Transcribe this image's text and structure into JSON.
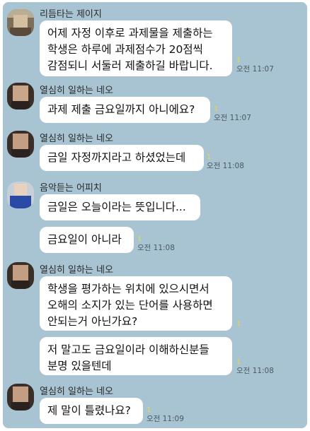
{
  "messages": [
    {
      "sender": "리듬타는 제이지",
      "lines": [
        "어제 자정 이후로 과제물을 제출하는",
        "학생은 하루에 과제점수가 20점씩",
        "감점되니 서둘러 제출하길 바랍니다."
      ],
      "read": "1",
      "time": "오전 11:07"
    },
    {
      "sender": "열심히 일하는 네오",
      "lines": [
        "과제 제출 금요일까지 아니에요?"
      ],
      "read": "1",
      "time": "오전 11:07"
    },
    {
      "sender": "열심히 일하는 네오",
      "lines": [
        "금일 자정까지라고 하셨었는데"
      ],
      "read": "1",
      "time": "오전 11:08"
    },
    {
      "sender": "음악듣는 어피치",
      "lines": [
        "금일은 오늘이라는 뜻입니다..."
      ],
      "read": "",
      "time": ""
    },
    {
      "sender": "",
      "lines": [
        "금요일이 아니라"
      ],
      "read": "1",
      "time": "오전 11:08"
    },
    {
      "sender": "열심히 일하는 네오",
      "lines": [
        "학생을 평가하는 위치에 있으시면서",
        "오해의 소지가 있는 단어를 사용하면",
        "안되는거 아닌가요?"
      ],
      "read": "1",
      "time": ""
    },
    {
      "sender": "",
      "lines": [
        "저 말고도 금요일이라 이해하신분들",
        "분명 있을텐데"
      ],
      "read": "1",
      "time": "오전 11:08"
    },
    {
      "sender": "열심히 일하는 네오",
      "lines": [
        "제 말이 틀렸나요?"
      ],
      "read": "1",
      "time": "오전 11:09"
    }
  ]
}
